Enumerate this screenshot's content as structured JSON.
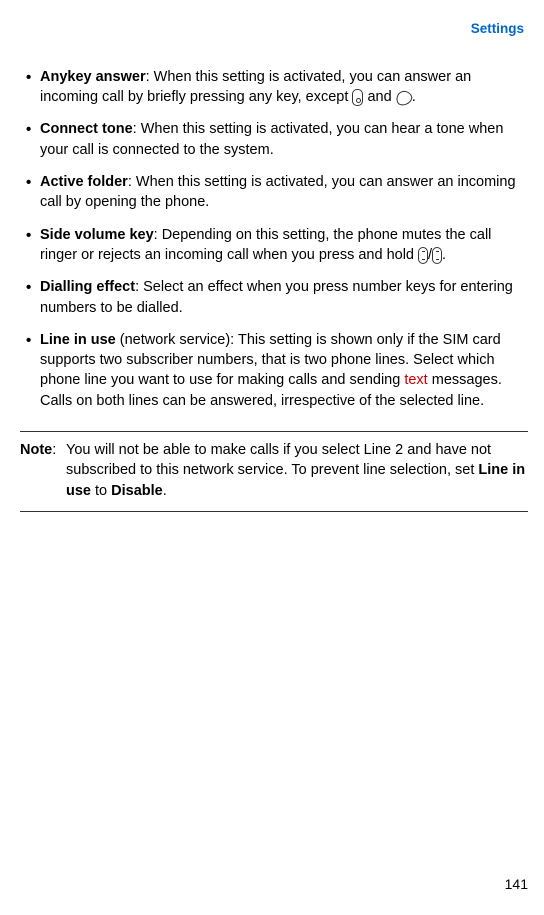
{
  "header": {
    "title": "Settings"
  },
  "items": [
    {
      "term": "Anykey answer",
      "text_before_icons": ": When this setting is activated, you can answer an incoming call by briefly pressing any key, except ",
      "mid": " and ",
      "text_after": "."
    },
    {
      "term": "Connect tone",
      "text": ": When this setting is activated, you can hear a tone when your call is connected to the system."
    },
    {
      "term": "Active folder",
      "text": ": When this setting is activated, you can answer an incoming call by opening the phone."
    },
    {
      "term": "Side volume key",
      "text_before": ": Depending on this setting, the phone mutes the call ringer or rejects an incoming call when you press and hold ",
      "slash": "/",
      "text_after": "."
    },
    {
      "term": "Dialling effect",
      "text": ": Select an effect when you press number keys for entering numbers to be dialled."
    },
    {
      "term": "Line in use",
      "paren": " (network service): ",
      "text_before_red": "This setting is shown only if the SIM card supports two subscriber numbers, that is two phone lines. Select which phone line you want to use for making calls and sending ",
      "red": "text",
      "text_after_red": " messages. Calls on both lines can be answered, irrespective of the selected line."
    }
  ],
  "note": {
    "label": "Note",
    "colon": ": ",
    "text_before_bold1": "You will not be able to make calls if you select Line 2 and have not subscribed to this network service. To prevent line selection, set ",
    "bold1": "Line in use",
    "mid": " to ",
    "bold2": "Disable",
    "end": "."
  },
  "page_number": "141"
}
